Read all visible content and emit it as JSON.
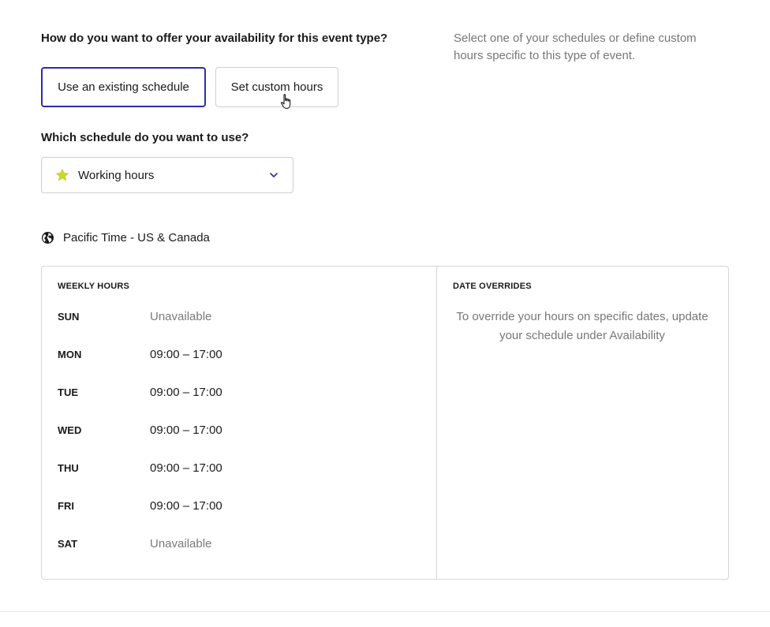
{
  "availability": {
    "question": "How do you want to offer your availability for this event type?",
    "helper_text": "Select one of your schedules or define custom hours specific to this type of event.",
    "options": [
      {
        "label": "Use an existing schedule",
        "selected": true
      },
      {
        "label": "Set custom hours",
        "selected": false
      }
    ]
  },
  "schedule": {
    "question": "Which schedule do you want to use?",
    "selected": "Working hours",
    "icon": "star-icon",
    "icon_color": "#c9d62b"
  },
  "timezone": {
    "label": "Pacific Time - US & Canada",
    "icon": "globe-icon"
  },
  "weekly": {
    "heading": "WEEKLY HOURS",
    "days": [
      {
        "day": "SUN",
        "hours": "Unavailable"
      },
      {
        "day": "MON",
        "hours": "09:00 – 17:00"
      },
      {
        "day": "TUE",
        "hours": "09:00 – 17:00"
      },
      {
        "day": "WED",
        "hours": "09:00 – 17:00"
      },
      {
        "day": "THU",
        "hours": "09:00 – 17:00"
      },
      {
        "day": "FRI",
        "hours": "09:00 – 17:00"
      },
      {
        "day": "SAT",
        "hours": "Unavailable"
      }
    ]
  },
  "overrides": {
    "heading": "DATE OVERRIDES",
    "text": "To override your hours on specific dates, update your schedule under Availability"
  },
  "colors": {
    "selected_border": "#2b2dad",
    "muted_text": "#777777"
  }
}
